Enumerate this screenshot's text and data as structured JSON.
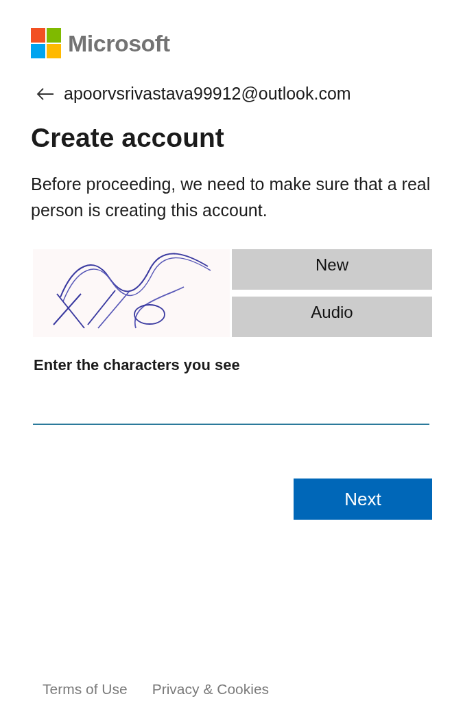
{
  "brand": {
    "name": "Microsoft"
  },
  "identity": {
    "email": "apoorvsrivastava99912@outlook.com"
  },
  "title": "Create account",
  "description": "Before proceeding, we need to make sure that a real person is creating this account.",
  "captcha": {
    "buttons": [
      "New",
      "Audio"
    ]
  },
  "field": {
    "label": "Enter the characters you see"
  },
  "primary_button": "Next",
  "footer_links": [
    "Terms of Use",
    "Privacy & Cookies"
  ]
}
